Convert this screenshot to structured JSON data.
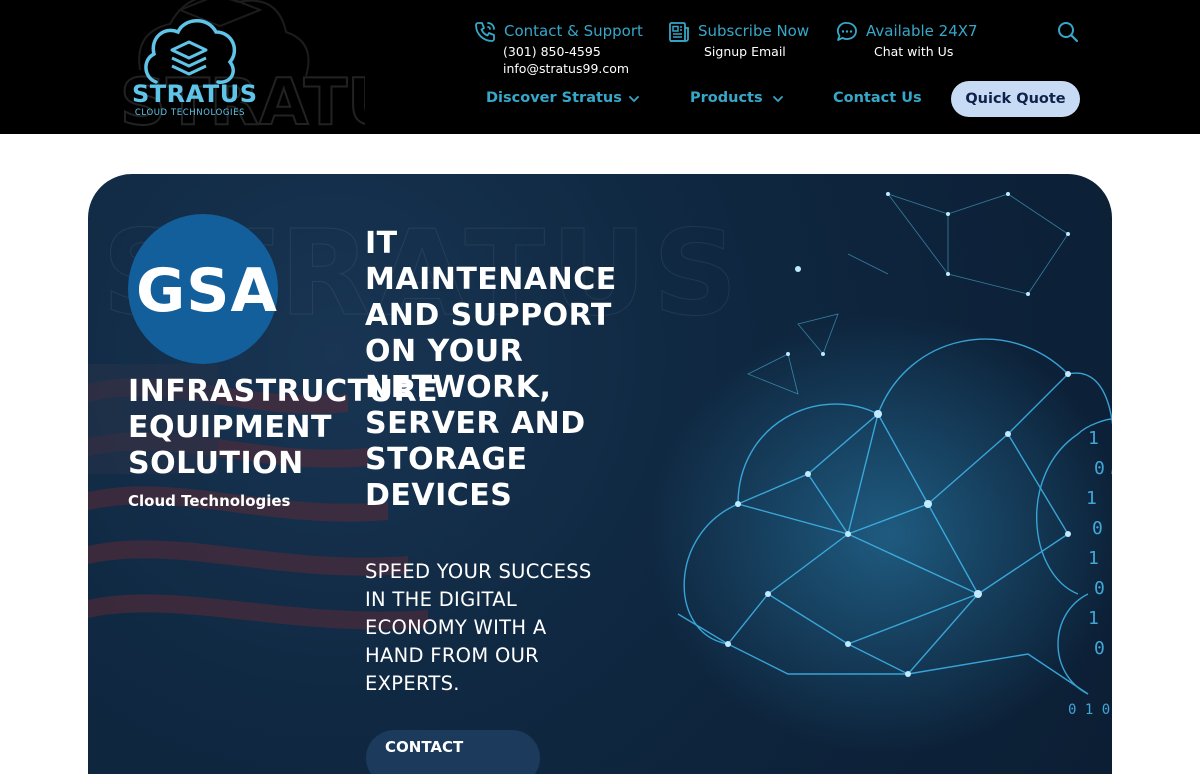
{
  "header": {
    "logo": {
      "name": "STRATUS",
      "tagline": "CLOUD TECHNOLOGIES",
      "icon": "cloud-stack-logo-icon"
    },
    "contact": {
      "title": "Contact & Support",
      "phone": "(301) 850-4595",
      "email": "info@stratus99.com",
      "icon": "phone-icon"
    },
    "subscribe": {
      "title": "Subscribe Now",
      "subtitle": "Signup Email",
      "icon": "newspaper-icon"
    },
    "chat": {
      "title": "Available 24X7",
      "subtitle": "Chat with Us",
      "icon": "chat-icon"
    },
    "search_icon": "search-icon",
    "nav": [
      {
        "label": "Discover Stratus",
        "has_dropdown": true
      },
      {
        "label": "Products",
        "has_dropdown": true
      },
      {
        "label": "Contact Us",
        "has_dropdown": false
      }
    ],
    "quote_button": "Quick Quote"
  },
  "hero": {
    "badge": "GSA",
    "left_title": "INFRASTRUCTURE EQUIPMENT SOLUTION",
    "left_subtitle": "Cloud Technologies",
    "title": "IT MAINTENANCE AND SUPPORT ON YOUR NETWORK, SERVER AND STORAGE DEVICES",
    "subtitle": "SPEED YOUR SUCCESS IN THE DIGITAL ECONOMY WITH A HAND FROM OUR EXPERTS.",
    "cta": "CONTACT"
  },
  "colors": {
    "header_bg": "#000000",
    "accent": "#36a7c9",
    "hero_bg": "#0f2740",
    "quote_button_bg": "#c7dcf4",
    "gsa_blue": "#135f9b"
  }
}
